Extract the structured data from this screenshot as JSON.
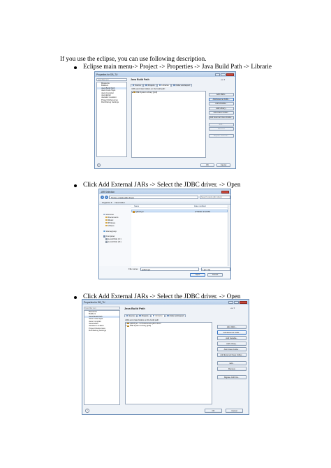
{
  "intro": "If you use the eclipse, you can use following description.",
  "steps": [
    "Eclipse main menu-> Project -> Properties -> Java Build Path -> Librarie",
    "Click Add External JARs -> Select the JDBC driver. -> Open",
    "Click Add External JARs -> Select the JDBC driver. -> Open"
  ],
  "props1": {
    "window_title": "Properties for DB_TU",
    "filter_placeholder": "type filter text",
    "tree": [
      "Resource",
      "Builders",
      "Java Build Path",
      "Java Code Style",
      "Java Compiler",
      "Java Editor",
      "Javadoc Location",
      "Project References",
      "Run/Debug Settings"
    ],
    "selected": "Java Build Path",
    "page_title": "Java Build Path",
    "tabs": [
      "Source",
      "Projects",
      "Libraries",
      "Order and Export"
    ],
    "active_tab": "Libraries",
    "caption": "JARs and class folders on the build path:",
    "entries": [
      "JRE System Library [jre6]"
    ],
    "buttons": [
      "Add JARs...",
      "Add External JARs...",
      "Add Variable...",
      "Add Library...",
      "Add Class Folder...",
      "Add External Class Folder...",
      "Edit...",
      "Remove",
      "Migrate JAR File..."
    ],
    "disabled_buttons": [
      "Edit...",
      "Remove",
      "Migrate JAR File..."
    ],
    "ok": "OK",
    "cancel": "Cancel"
  },
  "jar": {
    "window_title": "JAR Selection",
    "path": "Tools ▸ oracle jdbc driver",
    "search_placeholder": "Search oracle jdbc driver",
    "organize": "Organize ▾",
    "new_folder": "New folder",
    "nav": [
      "Libraries",
      "Documents",
      "Music",
      "Pictures",
      "Videos",
      "Homegroup",
      "Computer",
      "Local Disk (C:)",
      "Local Disk (D:)"
    ],
    "col_name": "Name",
    "col_date": "Date modified",
    "file_name": "ojdbc6.jar",
    "file_date": "2/7/2011 3:32 PM",
    "fn_label": "File name:",
    "fn_value": "ojdbc6.jar",
    "filter": "*.jar;*.zip",
    "open": "Open",
    "cancel": "Cancel"
  },
  "props2": {
    "window_title": "Properties for DB_TU",
    "filter_placeholder": "type filter text",
    "tree": [
      "Resource",
      "Builders",
      "Java Build Path",
      "Java Code Style",
      "Java Compiler",
      "Java Editor",
      "Javadoc Location",
      "Project References",
      "Run/Debug Settings"
    ],
    "selected": "Java Build Path",
    "page_title": "Java Build Path",
    "tabs": [
      "Source",
      "Projects",
      "Libraries",
      "Order and Export"
    ],
    "active_tab": "Libraries",
    "caption": "JARs and class folders on the build path:",
    "entries": [
      "ojdbc6.jar - D:\\Tools\\oracle jdbc driver",
      "JRE System Library [jre6]"
    ],
    "buttons": [
      "Add JARs...",
      "Add External JARs...",
      "Add Variable...",
      "Add Library...",
      "Add Class Folder...",
      "Add External Class Folder...",
      "Edit...",
      "Remove",
      "Migrate JAR File..."
    ],
    "disabled_buttons": [],
    "ok": "OK",
    "cancel": "Cancel"
  }
}
